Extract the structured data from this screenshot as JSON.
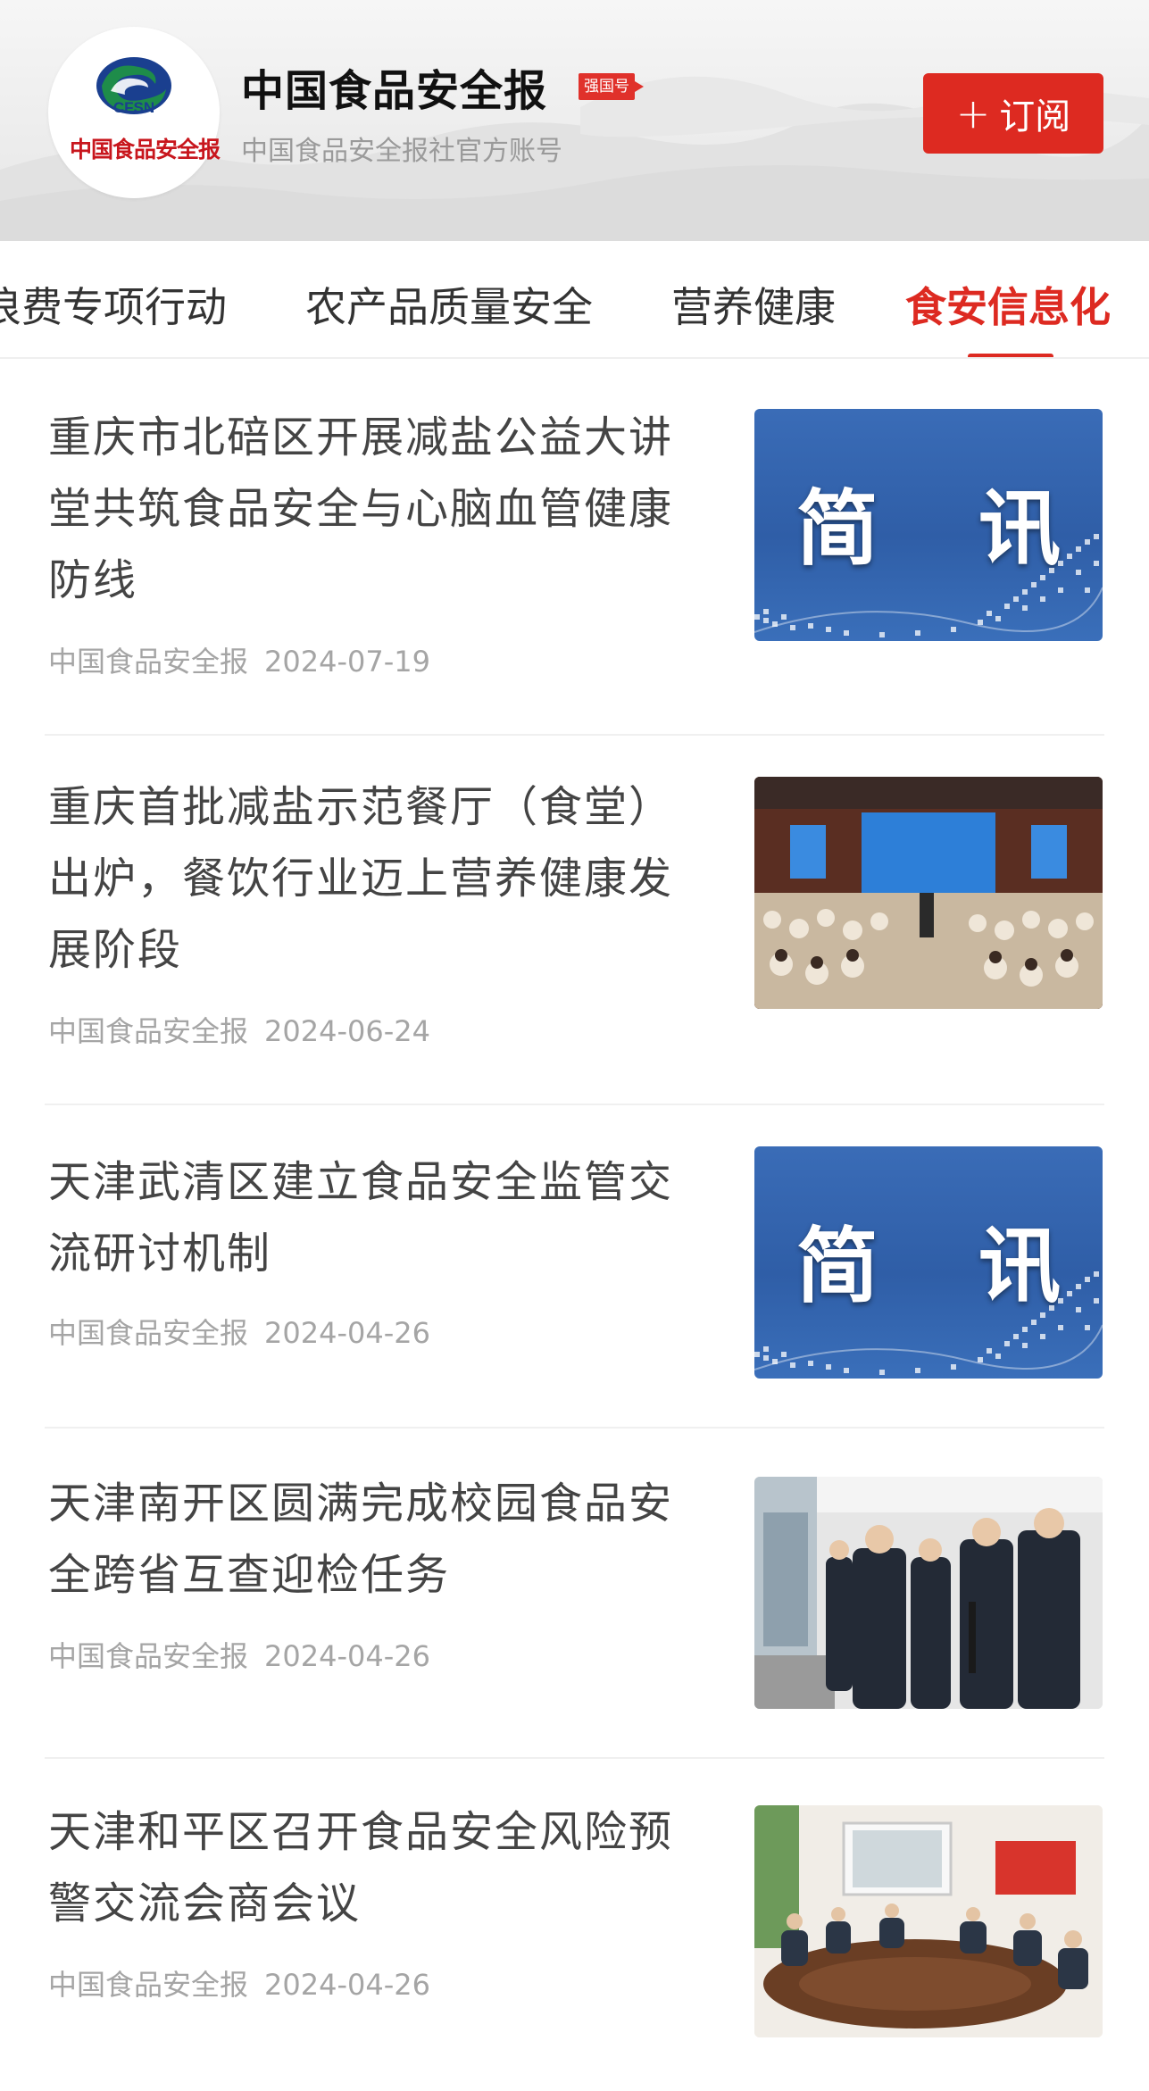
{
  "account": {
    "logo_abbr": "CFSN",
    "logo_text": "中国食品安全报",
    "name": "中国食品安全报",
    "badge": "强国号",
    "description": "中国食品安全报社官方账号",
    "subscribe_label": "订阅",
    "colors": {
      "accent": "#dd2a21",
      "logo_blue": "#1a3f8f",
      "logo_green": "#1e8c4a"
    }
  },
  "tabs": [
    {
      "label": "浪费专项行动",
      "active": false
    },
    {
      "label": "农产品质量安全",
      "active": false
    },
    {
      "label": "营养健康",
      "active": false
    },
    {
      "label": "食安信息化",
      "active": true
    }
  ],
  "articles": [
    {
      "title": "重庆市北碚区开展减盐公益大讲堂共筑食品安全与心脑血管健康防线",
      "source": "中国食品安全报",
      "date": "2024-07-19",
      "thumb": {
        "type": "brief",
        "text": "简 讯"
      }
    },
    {
      "title": "重庆首批减盐示范餐厅（食堂）出炉，餐饮行业迈上营养健康发展阶段",
      "source": "中国食品安全报",
      "date": "2024-06-24",
      "thumb": {
        "type": "photo",
        "subject": "conference-hall"
      }
    },
    {
      "title": "天津武清区建立食品安全监管交流研讨机制",
      "source": "中国食品安全报",
      "date": "2024-04-26",
      "thumb": {
        "type": "brief",
        "text": "简 讯"
      }
    },
    {
      "title": "天津南开区圆满完成校园食品安全跨省互查迎检任务",
      "source": "中国食品安全报",
      "date": "2024-04-26",
      "thumb": {
        "type": "photo",
        "subject": "canteen-inspection"
      }
    },
    {
      "title": "天津和平区召开食品安全风险预警交流会商会议",
      "source": "中国食品安全报",
      "date": "2024-04-26",
      "thumb": {
        "type": "photo",
        "subject": "meeting-room"
      }
    }
  ]
}
